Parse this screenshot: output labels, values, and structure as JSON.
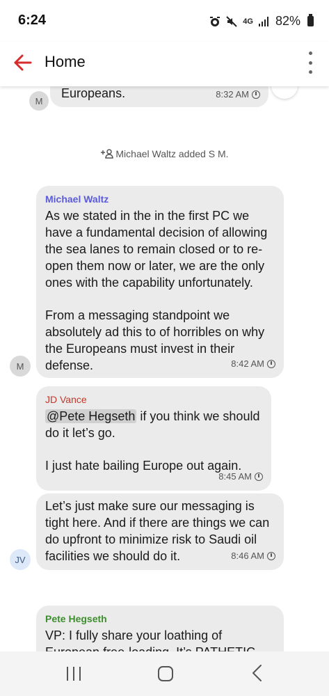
{
  "status_bar": {
    "time": "6:24",
    "network": "4G",
    "battery": "82%"
  },
  "header": {
    "title": "Home"
  },
  "messages": {
    "top_partial": {
      "text": "Europeans.",
      "time": "8:32 AM",
      "avatar": "M"
    },
    "system_notice": "Michael Waltz added S M.",
    "waltz": {
      "sender": "Michael Waltz",
      "sender_color": "#5b5bd6",
      "line1": "As we stated in the in the first PC we",
      "line2": "have a fundamental decision of allowing",
      "line3": "the sea lanes to remain closed or to re-",
      "line4": "open them now or later, we are the only",
      "line5": "ones with the capability unfortunately.",
      "line6": "From a messaging standpoint we",
      "line7": "absolutely ad this to of horribles on why",
      "line8": "the Europeans must invest in their",
      "line9": "defense.",
      "time": "8:42 AM",
      "avatar": "M"
    },
    "vance1": {
      "sender": "JD Vance",
      "sender_color": "#c0392b",
      "mention": "@Pete Hegseth",
      "line1_rest": " if you think we should",
      "line2": "do it let’s go.",
      "line3": "I just hate bailing Europe out again.",
      "time": "8:45 AM"
    },
    "vance2": {
      "line1": "Let’s just make sure our messaging is",
      "line2": "tight here. And if there are things we can",
      "line3": "do upfront to minimize risk to Saudi oil",
      "line4": "facilities we should do it.",
      "time": "8:46 AM",
      "avatar": "JV"
    },
    "hegseth": {
      "sender": "Pete Hegseth",
      "sender_color": "#3e8e2f",
      "line1": "VP: I fully share your loathing of",
      "line2": "European free-loading. It’s PATHETIC."
    }
  },
  "icons": {
    "back": "arrow-left-icon",
    "menu": "more-vert-icon",
    "clock": "clock-icon",
    "add_person": "add-person-icon"
  },
  "colors": {
    "accent": "#d62c2c",
    "bubble": "#ebebeb"
  }
}
